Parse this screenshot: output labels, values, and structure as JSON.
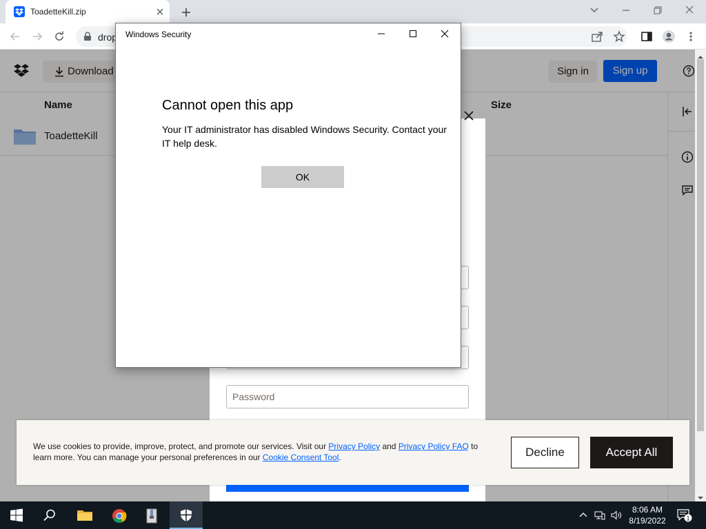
{
  "browser": {
    "tab_title": "ToadetteKill.zip",
    "url_partial": "drop"
  },
  "page": {
    "download_label": "Download",
    "signin_label": "Sign in",
    "signup_label": "Sign up",
    "col_name": "Name",
    "col_size": "Size",
    "file_name": "ToadetteKill"
  },
  "signin_modal": {
    "password_placeholder": "Password"
  },
  "cookie_banner": {
    "text_1": "We use cookies to provide, improve, protect, and promote our services. Visit our ",
    "link_1": "Privacy Policy",
    "text_2": " and ",
    "link_2": "Privacy Policy FAQ",
    "text_3": " to learn more. You can manage your personal preferences in our ",
    "link_3": "Cookie Consent Tool",
    "text_4": ".",
    "decline_label": "Decline",
    "accept_label": "Accept All"
  },
  "dialog": {
    "title": "Windows Security",
    "heading": "Cannot open this app",
    "message": "Your IT administrator has disabled Windows Security. Contact your IT help desk.",
    "ok_label": "OK"
  },
  "taskbar": {
    "time": "8:06 AM",
    "date": "8/19/2022",
    "notification_count": "1"
  },
  "colors": {
    "dropbox_blue": "#0061fe",
    "taskbar_bg": "#101820"
  }
}
